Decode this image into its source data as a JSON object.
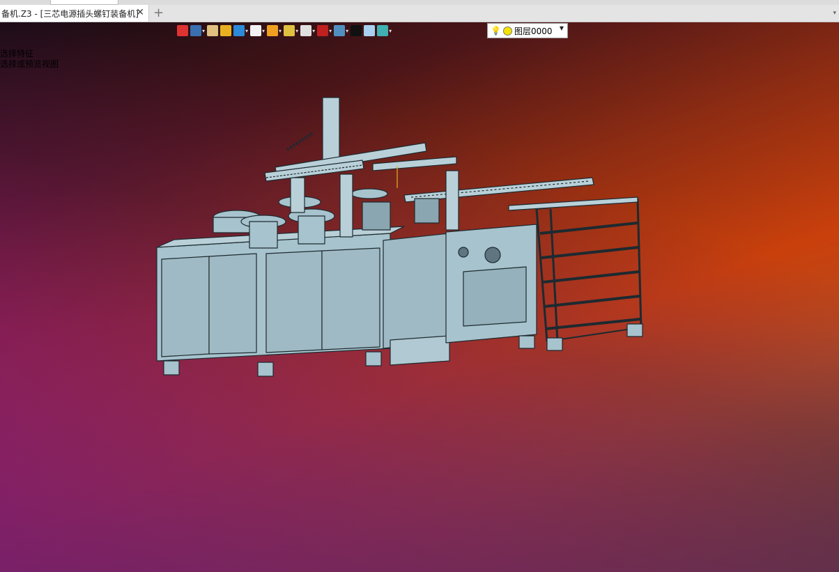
{
  "window": {
    "tab_title": "备机.Z3 - [三芯电源插头螺钉装备机]",
    "close_glyph": "✕",
    "new_tab_glyph": "+"
  },
  "prompt": {
    "line1": "选择特征",
    "line2": "选择或预览视图"
  },
  "toolbar": {
    "items": [
      {
        "name": "exit-icon",
        "color": "#d33"
      },
      {
        "name": "view-orient-icon",
        "color": "#3a6fb0"
      },
      {
        "name": "pencil-icon",
        "color": "#e0c080"
      },
      {
        "name": "solid-yellow-icon",
        "color": "#e8b020"
      },
      {
        "name": "solid-blue-icon",
        "color": "#2c8ad8"
      },
      {
        "name": "white-cube-icon",
        "color": "#f2f2f2"
      },
      {
        "name": "render-icon",
        "color": "#f0a020"
      },
      {
        "name": "zoom-icon",
        "color": "#e0c040"
      },
      {
        "name": "axes-icon",
        "color": "#e0e0e0"
      },
      {
        "name": "dimension-icon",
        "color": "#c02020"
      },
      {
        "name": "display-icon",
        "color": "#5090c0"
      },
      {
        "name": "black-rect-icon",
        "color": "#111111"
      },
      {
        "name": "light-blue-rect-icon",
        "color": "#a8d0f0"
      },
      {
        "name": "layer-stack-icon",
        "color": "#40b0b0"
      }
    ],
    "layer_name": "图层0000"
  },
  "model": {
    "body_color": "#a7c3cd",
    "edge_color": "#1d2a30"
  }
}
